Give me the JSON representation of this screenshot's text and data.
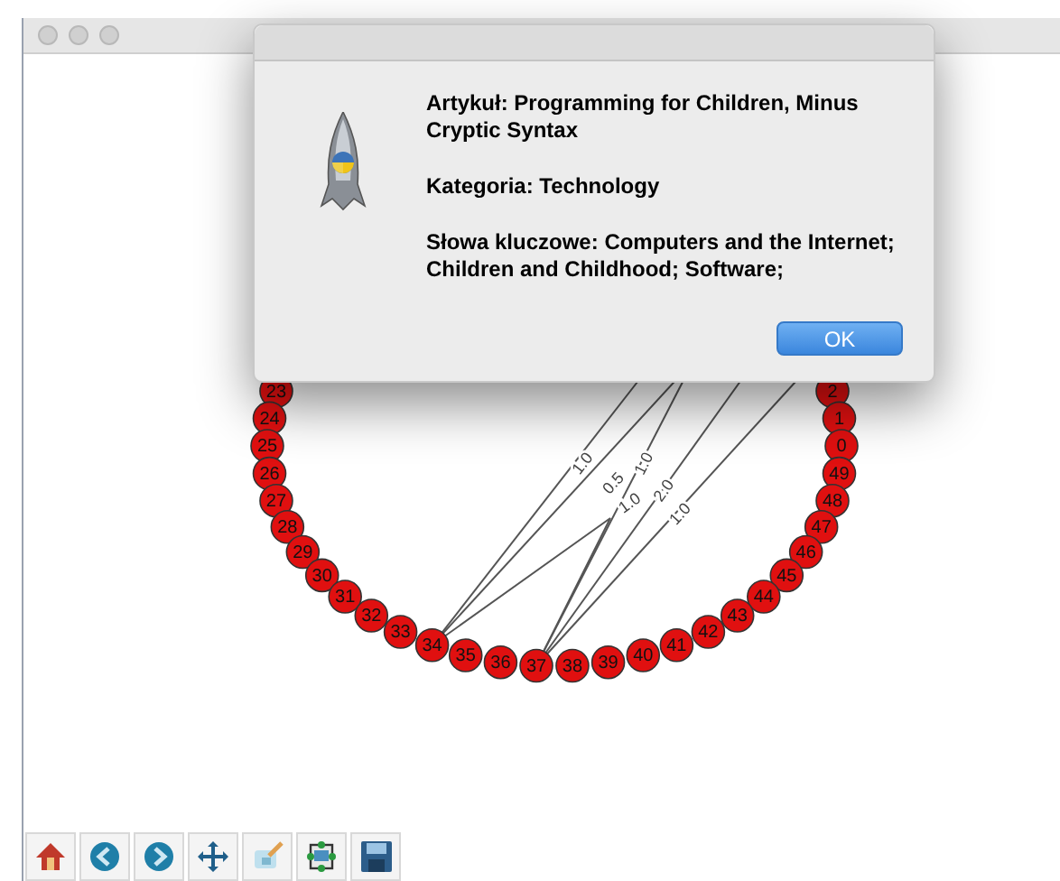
{
  "dialog": {
    "paragraphs": [
      "Artykuł: Programming for Children, Minus Cryptic Syntax",
      "Kategoria: Technology",
      "Słowa kluczowe: Computers and the Internet; Children and Childhood; Software;"
    ],
    "button": "OK"
  },
  "graph": {
    "nodes": [
      "23",
      "2",
      "24",
      "1",
      "25",
      "0",
      "26",
      "49",
      "27",
      "48",
      "28",
      "47",
      "29",
      "46",
      "30",
      "45",
      "31",
      "44",
      "32",
      "43",
      "33",
      "34",
      "35",
      "36",
      "37",
      "38",
      "39",
      "40",
      "41",
      "42"
    ],
    "edges": [
      {
        "label": "1.0"
      },
      {
        "label": "0.5"
      },
      {
        "label": "1.0"
      },
      {
        "label": "1.0"
      },
      {
        "label": "2.0"
      },
      {
        "label": "1.0"
      }
    ]
  }
}
